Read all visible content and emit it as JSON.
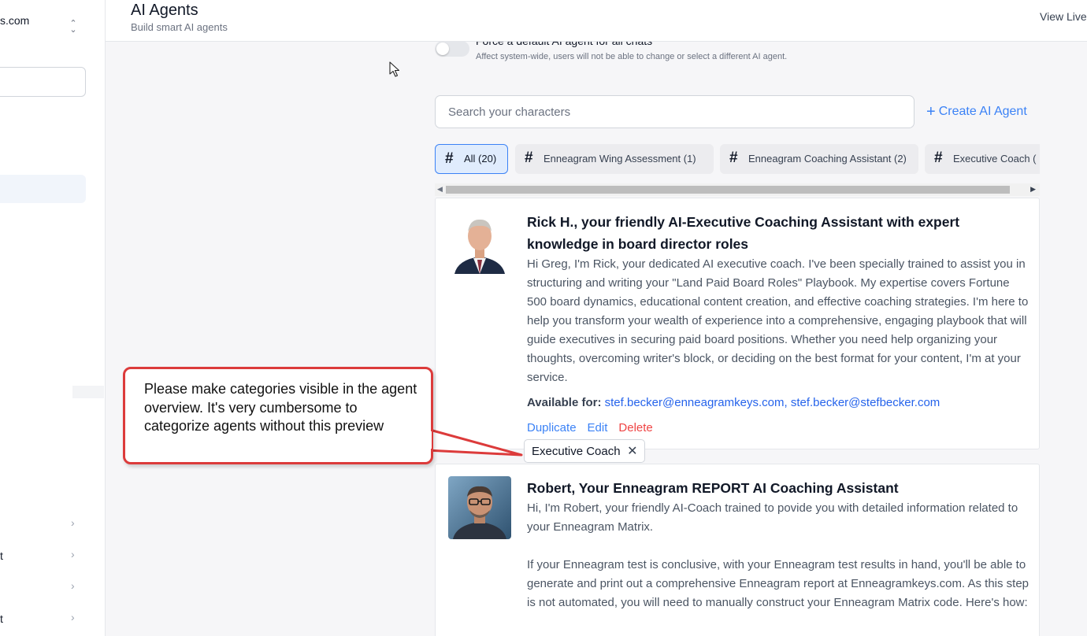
{
  "sidebar": {
    "workspace_name": "s.com",
    "search_value": "",
    "nav_items": [
      {
        "label": ""
      },
      {
        "label": "t"
      },
      {
        "label": ""
      },
      {
        "label": "t"
      }
    ]
  },
  "header": {
    "title": "AI Agents",
    "subtitle": "Build smart AI agents",
    "view_live": "View Live"
  },
  "default_agent": {
    "label": "Force a default AI agent for all chats",
    "description": "Affect system-wide, users will not be able to change or select a different AI agent.",
    "enabled": false
  },
  "search": {
    "placeholder": "Search your characters",
    "value": ""
  },
  "create_label": "Create AI Agent",
  "categories": [
    {
      "label": "All (20)",
      "active": true
    },
    {
      "label": "Enneagram Wing Assessment (1)",
      "active": false
    },
    {
      "label": "Enneagram Coaching Assistant (2)",
      "active": false
    },
    {
      "label": "Executive Coach (",
      "active": false
    }
  ],
  "agents": [
    {
      "title": "Rick H., your friendly AI-Executive Coaching Assistant with expert knowledge in board director roles",
      "description": "Hi Greg, I'm Rick, your dedicated AI executive coach. I've been specially trained to assist you in structuring and writing your \"Land Paid Board Roles\" Playbook. My expertise covers Fortune 500 board dynamics, educational content creation, and effective coaching strategies. I'm here to help you transform your wealth of experience into a comprehensive, engaging playbook that will guide executives in securing paid board positions. Whether you need help organizing your thoughts, overcoming writer's block, or deciding on the best format for your content, I'm at your service.",
      "available_label": "Available for:",
      "emails": [
        "stef.becker@enneagramkeys.com",
        "stef.becker@stefbecker.com"
      ],
      "actions": {
        "duplicate": "Duplicate",
        "edit": "Edit",
        "delete": "Delete"
      },
      "tag": "Executive Coach"
    },
    {
      "title": "Robert, Your Enneagram REPORT AI Coaching Assistant",
      "description": "Hi, I'm Robert, your friendly AI-Coach trained to povide you with detailed information related to your Enneagram Matrix.\n\nIf your Enneagram test is conclusive, with your Enneagram test results in hand, you'll be able to generate and print out a comprehensive Enneagram report at Enneagramkeys.com. As this step is not automated, you will need to manually construct your Enneagram Matrix code. Here's how:"
    }
  ],
  "annotation": {
    "text": "Please make categories visible in the agent overview. It's very cumbersome to categorize agents without this preview",
    "border_color": "#dc3b3b"
  },
  "colors": {
    "accent": "#3b82f6",
    "link": "#2563eb",
    "danger": "#ef4444",
    "chip_active_bg": "#e0ecfd"
  }
}
